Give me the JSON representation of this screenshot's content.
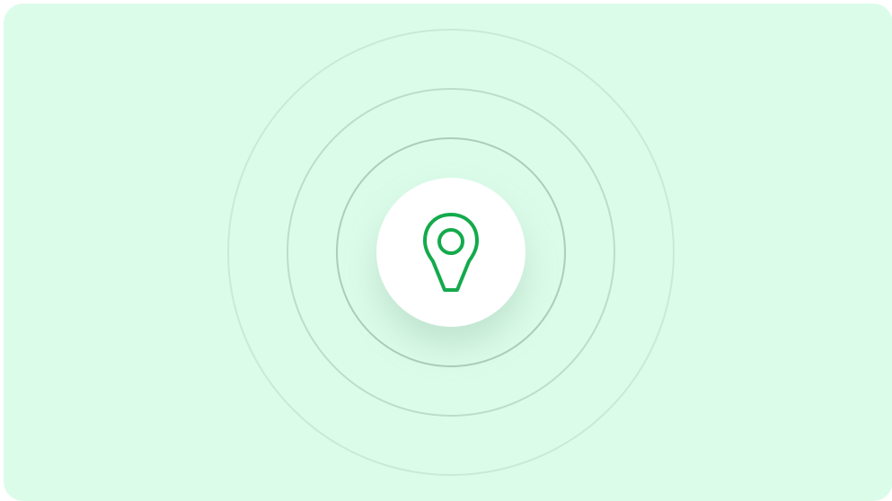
{
  "scene": {
    "icon": "location-pin-icon",
    "colors": {
      "background": "#dcfcea",
      "accent": "#14aa4c",
      "disc": "#ffffff"
    }
  }
}
